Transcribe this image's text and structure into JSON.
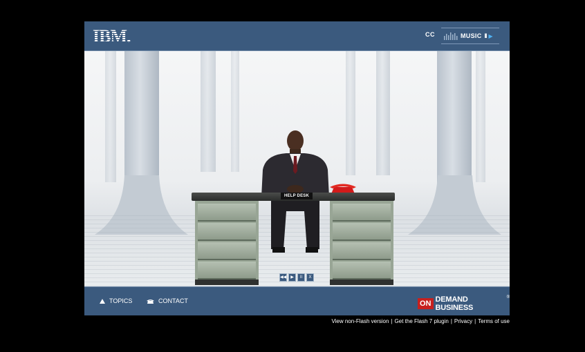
{
  "header": {
    "logo_text": "IBM.",
    "cc_label": "CC",
    "music_label": "MUSIC",
    "music_pause_glyph": "II",
    "music_play_glyph": "▶"
  },
  "scene": {
    "sign_label": "HELP DESK",
    "controls": [
      {
        "icon": "rewind-icon",
        "glyph": "◀◀"
      },
      {
        "icon": "play-icon",
        "glyph": "▶"
      },
      {
        "icon": "pause-icon",
        "glyph": "II"
      },
      {
        "icon": "close-icon",
        "glyph": "X"
      }
    ]
  },
  "bottom": {
    "topics_label": "TOPICS",
    "contact_label": "CONTACT",
    "on_label": "ON",
    "demand_label": "DEMAND BUSINESS",
    "trademark": "®"
  },
  "footer": {
    "links": [
      "View non-Flash version",
      "Get the Flash 7 plugin",
      "Privacy",
      "Terms of use"
    ],
    "separator": "|"
  },
  "colors": {
    "bar_blue": "#3b5a7e",
    "accent_red": "#c8201e",
    "play_blue": "#4fb1f2"
  }
}
